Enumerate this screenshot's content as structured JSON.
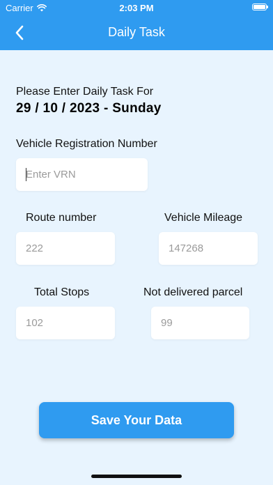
{
  "status_bar": {
    "carrier": "Carrier",
    "time": "2:03 PM"
  },
  "nav": {
    "title": "Daily Task"
  },
  "intro": {
    "prompt": "Please Enter Daily Task For",
    "date": "29 / 10 / 2023 - Sunday"
  },
  "vrn": {
    "label": "Vehicle Registration Number",
    "placeholder": "Enter VRN"
  },
  "route": {
    "label": "Route number",
    "placeholder": "222"
  },
  "mileage": {
    "label": "Vehicle Mileage",
    "placeholder": "147268"
  },
  "stops": {
    "label": "Total Stops",
    "placeholder": "102"
  },
  "not_delivered": {
    "label": "Not delivered parcel",
    "placeholder": "99"
  },
  "save": {
    "label": "Save Your Data"
  },
  "colors": {
    "primary": "#2f9bf0",
    "background": "#e8f4fe"
  }
}
